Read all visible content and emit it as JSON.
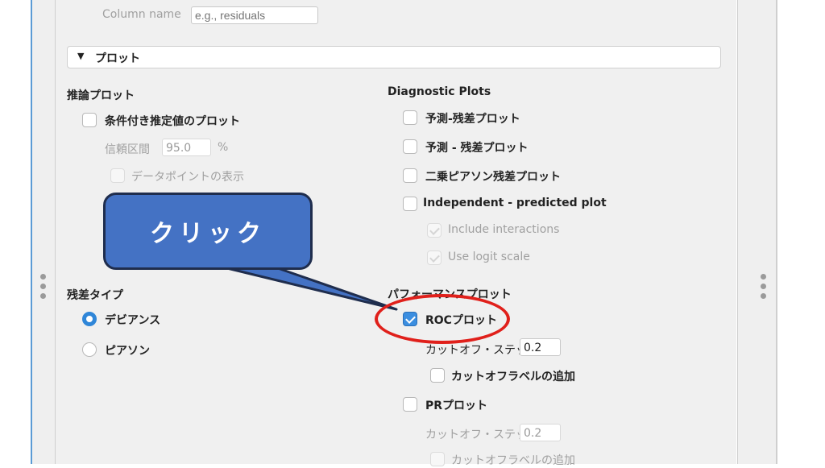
{
  "top": {
    "column_name_label": "Column name",
    "column_name_placeholder": "e.g., residuals"
  },
  "section": {
    "toggle_icon": "triangle-down-icon",
    "title": "プロット"
  },
  "inference": {
    "heading": "推論プロット",
    "conditional_label": "条件付き推定値のプロット",
    "ci_label": "信頼区間",
    "ci_value": "95.0",
    "ci_unit": "%",
    "datapoints_label": "データポイントの表示"
  },
  "residual_type": {
    "heading": "残差タイプ",
    "options": [
      "デビアンス",
      "ピアソン"
    ],
    "selected": "デビアンス"
  },
  "diagnostic": {
    "heading": "Diagnostic Plots",
    "items": [
      "予測-残差プロット",
      "予測 - 残差プロット",
      "二乗ピアソン残差プロット",
      "Independent - predicted plot"
    ],
    "include_interactions": "Include interactions",
    "use_logit_scale": "Use logit scale"
  },
  "performance": {
    "heading": "パフォーマンスプロット",
    "roc_label": "ROCプロット",
    "roc_checked": true,
    "roc_cutoff_label": "カットオフ・ステップ",
    "roc_cutoff_value": "0.2",
    "roc_add_labels": "カットオフラベルの追加",
    "pr_label": "PRプロット",
    "pr_cutoff_label": "カットオフ・ステップ",
    "pr_cutoff_value": "0.2",
    "pr_add_labels": "カットオフラベルの追加"
  },
  "annotation": {
    "callout_text": "クリック",
    "callout_color": "#4472c4",
    "ring_color": "#e0201b"
  }
}
